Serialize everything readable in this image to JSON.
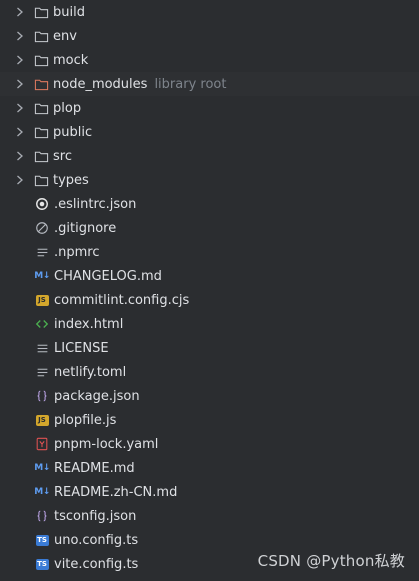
{
  "folders": [
    {
      "name": "build",
      "icon": "folder-icon"
    },
    {
      "name": "env",
      "icon": "folder-icon"
    },
    {
      "name": "mock",
      "icon": "folder-icon"
    },
    {
      "name": "node_modules",
      "icon": "folder-excluded-icon",
      "hint": "library root"
    },
    {
      "name": "plop",
      "icon": "folder-icon"
    },
    {
      "name": "public",
      "icon": "folder-icon"
    },
    {
      "name": "src",
      "icon": "folder-icon"
    },
    {
      "name": "types",
      "icon": "folder-icon"
    }
  ],
  "files": [
    {
      "name": ".eslintrc.json",
      "icon": "eslint-icon"
    },
    {
      "name": ".gitignore",
      "icon": "gitignore-icon"
    },
    {
      "name": ".npmrc",
      "icon": "text-file-icon"
    },
    {
      "name": "CHANGELOG.md",
      "icon": "markdown-icon"
    },
    {
      "name": "commitlint.config.cjs",
      "icon": "javascript-icon"
    },
    {
      "name": "index.html",
      "icon": "html-icon"
    },
    {
      "name": "LICENSE",
      "icon": "text-file-icon"
    },
    {
      "name": "netlify.toml",
      "icon": "text-file-icon"
    },
    {
      "name": "package.json",
      "icon": "json-icon"
    },
    {
      "name": "plopfile.js",
      "icon": "javascript-icon"
    },
    {
      "name": "pnpm-lock.yaml",
      "icon": "yaml-icon"
    },
    {
      "name": "README.md",
      "icon": "markdown-icon"
    },
    {
      "name": "README.zh-CN.md",
      "icon": "markdown-icon"
    },
    {
      "name": "tsconfig.json",
      "icon": "json-icon"
    },
    {
      "name": "uno.config.ts",
      "icon": "typescript-icon"
    },
    {
      "name": "vite.config.ts",
      "icon": "typescript-icon"
    }
  ],
  "icon_glyphs": {
    "javascript": "JS",
    "typescript": "TS",
    "markdown": "M↓",
    "yaml": "Y"
  },
  "watermark": "CSDN @Python私教",
  "colors": {
    "background": "#2b2d30",
    "text": "#dfe1e5",
    "muted": "#7e848c",
    "folder": "#c8cbd0",
    "excluded_folder": "#e07a5f",
    "javascript": "#d4a72c",
    "typescript": "#3a7bd5",
    "markdown": "#5e9cf0",
    "html": "#4caf50",
    "json": "#b39ddb",
    "yaml": "#e05252"
  }
}
